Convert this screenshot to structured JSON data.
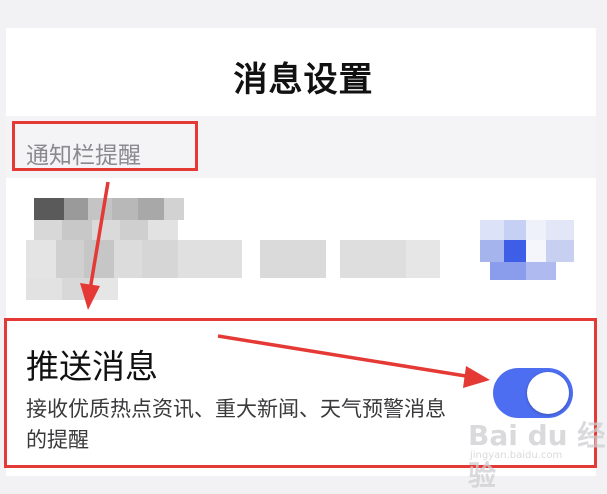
{
  "header": {
    "title": "消息设置"
  },
  "section": {
    "label": "通知栏提醒"
  },
  "push_setting": {
    "title": "推送消息",
    "description": "接收优质热点资讯、重大新闻、天气预警消息的提醒",
    "enabled": true
  },
  "colors": {
    "accent": "#4e6ef2",
    "annotation": "#e53935"
  },
  "watermark": {
    "brand": "Bai du 经验",
    "sub": "jingyan.baidu.com"
  }
}
